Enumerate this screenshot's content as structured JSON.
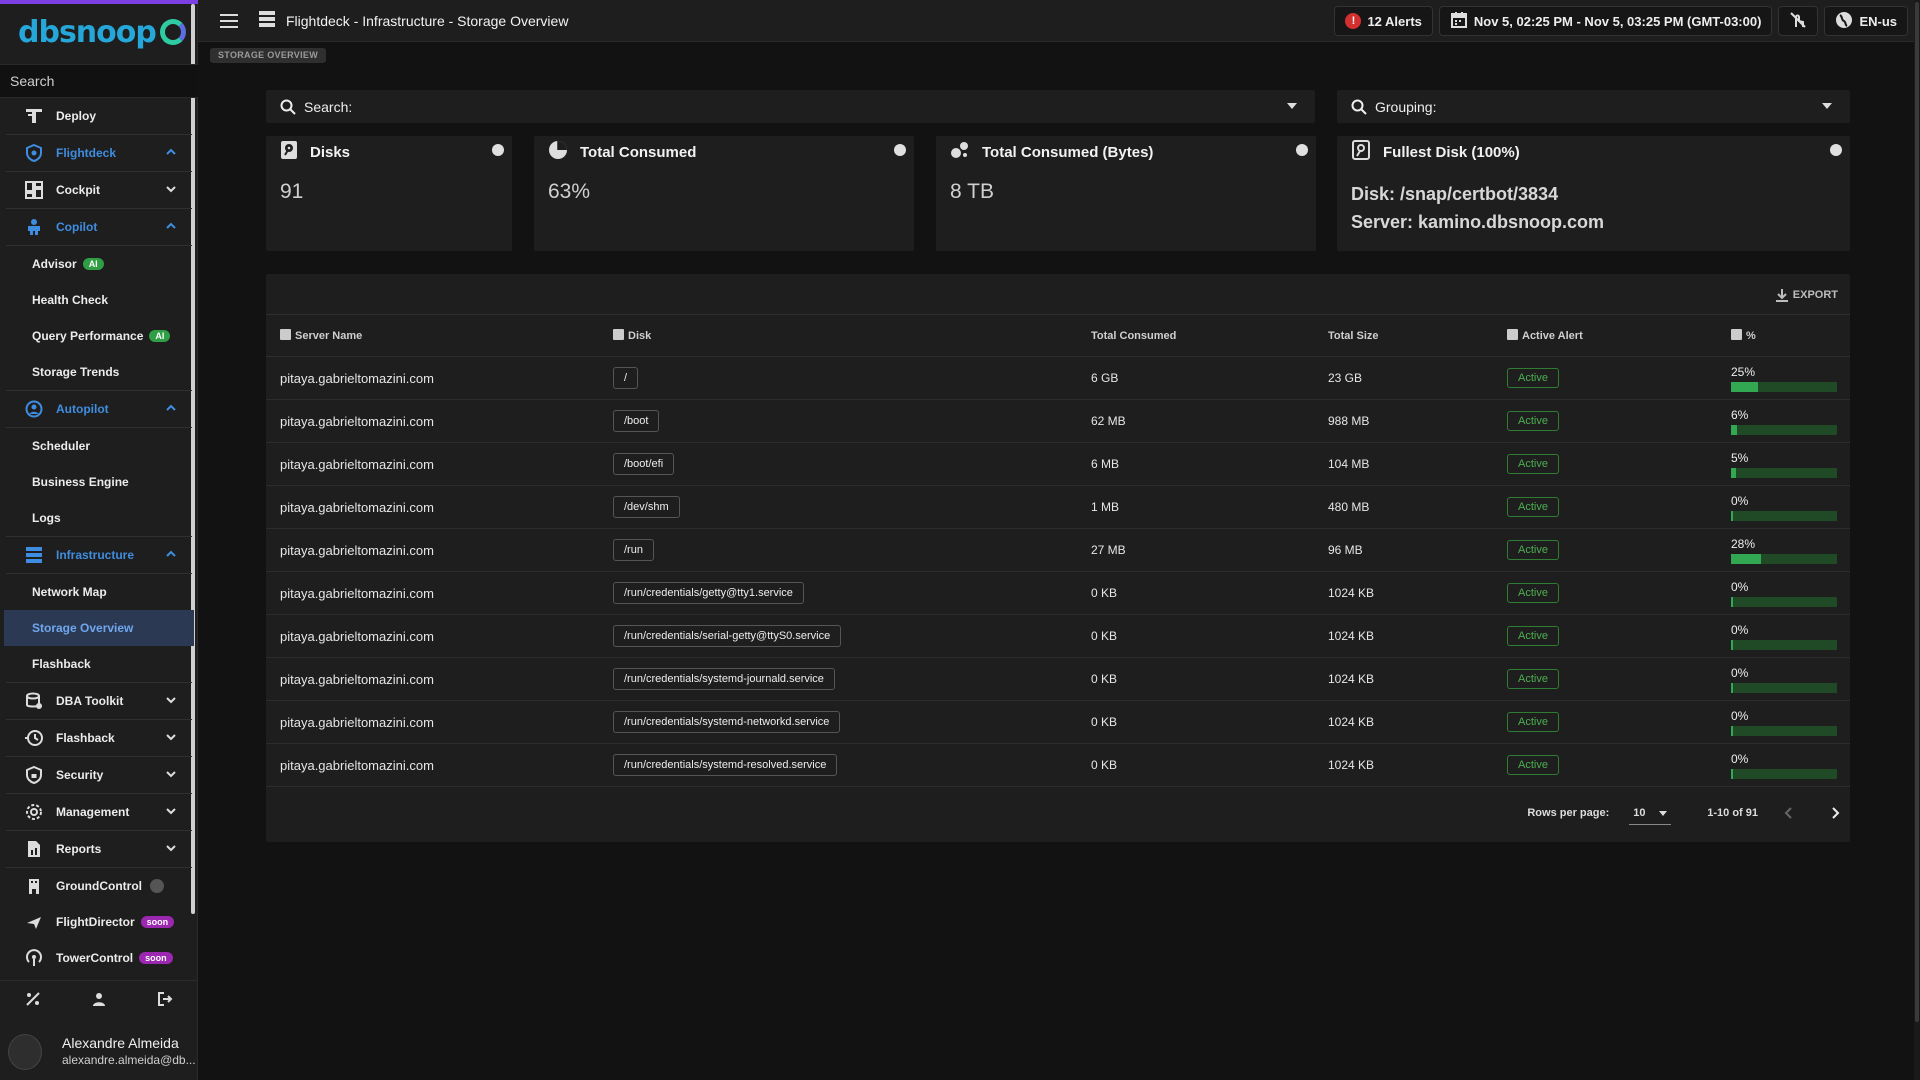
{
  "app": {
    "logo_text": "dbsnoop",
    "sidebar_search_placeholder": "Search",
    "title": "Flightdeck - Infrastructure - Storage Overview",
    "breadcrumb": "STORAGE OVERVIEW"
  },
  "topbar": {
    "alerts_label": "12 Alerts",
    "alert_icon_glyph": "!",
    "date_range": "Nov 5, 02:25 PM - Nov 5, 03:25 PM (GMT-03:00)",
    "locale": "EN-us"
  },
  "sidebar": {
    "items": [
      {
        "label": "Deploy",
        "icon": "deploy-icon"
      },
      {
        "label": "Flightdeck",
        "icon": "shield-icon"
      },
      {
        "label": "Cockpit",
        "icon": "dashboard-icon"
      },
      {
        "label": "Copilot",
        "icon": "copilot-icon"
      },
      {
        "label": "Advisor",
        "badge": "AI"
      },
      {
        "label": "Health Check"
      },
      {
        "label": "Query Performance",
        "badge": "AI"
      },
      {
        "label": "Storage Trends"
      },
      {
        "label": "Autopilot",
        "icon": "autopilot-icon"
      },
      {
        "label": "Scheduler"
      },
      {
        "label": "Business Engine"
      },
      {
        "label": "Logs"
      },
      {
        "label": "Infrastructure",
        "icon": "server-icon"
      },
      {
        "label": "Network Map"
      },
      {
        "label": "Storage Overview"
      },
      {
        "label": "Flashback"
      },
      {
        "label": "DBA Toolkit",
        "icon": "toolkit-icon"
      },
      {
        "label": "Flashback",
        "icon": "history-icon"
      },
      {
        "label": "Security",
        "icon": "security-icon"
      },
      {
        "label": "Management",
        "icon": "gear-icon"
      },
      {
        "label": "Reports",
        "icon": "reports-icon"
      },
      {
        "label": "GroundControl",
        "icon": "groundcontrol-icon"
      },
      {
        "label": "FlightDirector",
        "icon": "plane-icon",
        "badge": "soon"
      },
      {
        "label": "TowerControl",
        "icon": "tower-icon",
        "badge": "soon"
      }
    ],
    "user": {
      "name": "Alexandre Almeida",
      "email": "alexandre.almeida@db..."
    }
  },
  "filters": {
    "search_label": "Search:",
    "grouping_label": "Grouping:"
  },
  "cards": {
    "disks": {
      "title": "Disks",
      "value": "91"
    },
    "total_consumed": {
      "title": "Total Consumed",
      "value": "63%"
    },
    "total_consumed_bytes": {
      "title": "Total Consumed (Bytes)",
      "value": "8 TB"
    },
    "fullest_disk": {
      "title": "Fullest Disk (100%)",
      "disk": "Disk: /snap/certbot/3834",
      "server": "Server: kamino.dbsnoop.com"
    }
  },
  "table": {
    "export_label": "EXPORT",
    "columns": {
      "server": "Server Name",
      "disk": "Disk",
      "consumed": "Total Consumed",
      "size": "Total Size",
      "alert": "Active Alert",
      "pct": "%"
    },
    "rows": [
      {
        "server": "pitaya.gabrieltomazini.com",
        "disk": "/",
        "consumed": "6 GB",
        "size": "23 GB",
        "alert": "Active",
        "pct_label": "25%",
        "pct": 25
      },
      {
        "server": "pitaya.gabrieltomazini.com",
        "disk": "/boot",
        "consumed": "62 MB",
        "size": "988 MB",
        "alert": "Active",
        "pct_label": "6%",
        "pct": 6
      },
      {
        "server": "pitaya.gabrieltomazini.com",
        "disk": "/boot/efi",
        "consumed": "6 MB",
        "size": "104 MB",
        "alert": "Active",
        "pct_label": "5%",
        "pct": 5
      },
      {
        "server": "pitaya.gabrieltomazini.com",
        "disk": "/dev/shm",
        "consumed": "1 MB",
        "size": "480 MB",
        "alert": "Active",
        "pct_label": "0%",
        "pct": 0
      },
      {
        "server": "pitaya.gabrieltomazini.com",
        "disk": "/run",
        "consumed": "27 MB",
        "size": "96 MB",
        "alert": "Active",
        "pct_label": "28%",
        "pct": 28
      },
      {
        "server": "pitaya.gabrieltomazini.com",
        "disk": "/run/credentials/getty@tty1.service",
        "consumed": "0 KB",
        "size": "1024 KB",
        "alert": "Active",
        "pct_label": "0%",
        "pct": 0
      },
      {
        "server": "pitaya.gabrieltomazini.com",
        "disk": "/run/credentials/serial-getty@ttyS0.service",
        "consumed": "0 KB",
        "size": "1024 KB",
        "alert": "Active",
        "pct_label": "0%",
        "pct": 0
      },
      {
        "server": "pitaya.gabrieltomazini.com",
        "disk": "/run/credentials/systemd-journald.service",
        "consumed": "0 KB",
        "size": "1024 KB",
        "alert": "Active",
        "pct_label": "0%",
        "pct": 0
      },
      {
        "server": "pitaya.gabrieltomazini.com",
        "disk": "/run/credentials/systemd-networkd.service",
        "consumed": "0 KB",
        "size": "1024 KB",
        "alert": "Active",
        "pct_label": "0%",
        "pct": 0
      },
      {
        "server": "pitaya.gabrieltomazini.com",
        "disk": "/run/credentials/systemd-resolved.service",
        "consumed": "0 KB",
        "size": "1024 KB",
        "alert": "Active",
        "pct_label": "0%",
        "pct": 0
      }
    ]
  },
  "pagination": {
    "rows_per_page_label": "Rows per page:",
    "rows_per_page": "10",
    "range": "1-10 of 91"
  },
  "colors": {
    "accent": "#3f8de0",
    "active_green": "#4caf50",
    "bar_fill": "#33a852",
    "bar_track": "#1f4a25",
    "alert_red": "#d32f2f"
  }
}
